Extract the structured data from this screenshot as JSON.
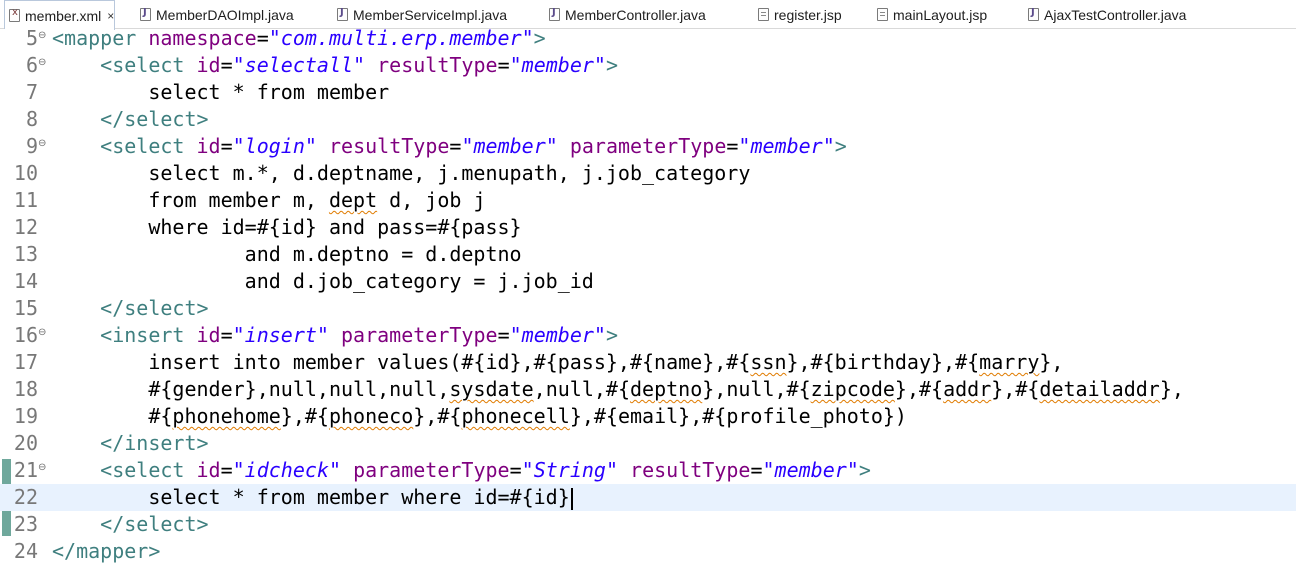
{
  "tabs": [
    {
      "label": "member.xml",
      "icon": "xml-file-icon",
      "active": true
    },
    {
      "label": "MemberDAOImpl.java",
      "icon": "java-file-icon"
    },
    {
      "label": "MemberServiceImpl.java",
      "icon": "java-file-icon"
    },
    {
      "label": "MemberController.java",
      "icon": "java-file-icon"
    },
    {
      "label": "register.jsp",
      "icon": "jsp-file-icon"
    },
    {
      "label": "mainLayout.jsp",
      "icon": "jsp-file-icon"
    },
    {
      "label": "AjaxTestController.java",
      "icon": "java-file-icon"
    }
  ],
  "tab_close_glyph": "×",
  "editor": {
    "current_line": 22,
    "lines": [
      {
        "n": "5",
        "fold": "⊖",
        "segs": [
          [
            "tag",
            "<mapper "
          ],
          [
            "att",
            "namespace"
          ],
          [
            "plain",
            "="
          ],
          [
            "val",
            "\"com.multi.erp.member\""
          ],
          [
            "tag",
            ">"
          ]
        ]
      },
      {
        "n": "6",
        "fold": "⊖",
        "segs": [
          [
            "plain",
            "    "
          ],
          [
            "tag",
            "<select "
          ],
          [
            "att",
            "id"
          ],
          [
            "plain",
            "="
          ],
          [
            "val",
            "\"selectall\""
          ],
          [
            "plain",
            " "
          ],
          [
            "att",
            "resultType"
          ],
          [
            "plain",
            "="
          ],
          [
            "val",
            "\"member\""
          ],
          [
            "tag",
            ">"
          ]
        ]
      },
      {
        "n": "7",
        "segs": [
          [
            "plain",
            "        select * from member"
          ]
        ]
      },
      {
        "n": "8",
        "segs": [
          [
            "plain",
            "    "
          ],
          [
            "tag",
            "</select>"
          ]
        ]
      },
      {
        "n": "9",
        "fold": "⊖",
        "segs": [
          [
            "plain",
            "    "
          ],
          [
            "tag",
            "<select "
          ],
          [
            "att",
            "id"
          ],
          [
            "plain",
            "="
          ],
          [
            "val",
            "\"login\""
          ],
          [
            "plain",
            " "
          ],
          [
            "att",
            "resultType"
          ],
          [
            "plain",
            "="
          ],
          [
            "val",
            "\"member\""
          ],
          [
            "plain",
            " "
          ],
          [
            "att",
            "parameterType"
          ],
          [
            "plain",
            "="
          ],
          [
            "val",
            "\"member\""
          ],
          [
            "tag",
            ">"
          ]
        ]
      },
      {
        "n": "10",
        "segs": [
          [
            "plain",
            "        select m.*, d.deptname, j.menupath, j.job_category"
          ]
        ]
      },
      {
        "n": "11",
        "segs": [
          [
            "plain",
            "        from member m, "
          ],
          [
            "ul",
            "dept"
          ],
          [
            "plain",
            " d, job j"
          ]
        ]
      },
      {
        "n": "12",
        "segs": [
          [
            "plain",
            "        where id=#{id} and pass=#{pass}"
          ]
        ]
      },
      {
        "n": "13",
        "segs": [
          [
            "plain",
            "                and m.deptno = d.deptno"
          ]
        ]
      },
      {
        "n": "14",
        "segs": [
          [
            "plain",
            "                and d.job_category = j.job_id"
          ]
        ]
      },
      {
        "n": "15",
        "segs": [
          [
            "plain",
            "    "
          ],
          [
            "tag",
            "</select>"
          ]
        ]
      },
      {
        "n": "16",
        "fold": "⊖",
        "segs": [
          [
            "plain",
            "    "
          ],
          [
            "tag",
            "<insert "
          ],
          [
            "att",
            "id"
          ],
          [
            "plain",
            "="
          ],
          [
            "val",
            "\"insert\""
          ],
          [
            "plain",
            " "
          ],
          [
            "att",
            "parameterType"
          ],
          [
            "plain",
            "="
          ],
          [
            "val",
            "\"member\""
          ],
          [
            "tag",
            ">"
          ]
        ]
      },
      {
        "n": "17",
        "segs": [
          [
            "plain",
            "        insert into member values(#{id},#{pass},#{name},#{"
          ],
          [
            "ul",
            "ssn"
          ],
          [
            "plain",
            "},#{birthday},#{"
          ],
          [
            "ul",
            "marry"
          ],
          [
            "plain",
            "},"
          ]
        ]
      },
      {
        "n": "18",
        "segs": [
          [
            "plain",
            "        #{gender},null,null,null,"
          ],
          [
            "ul",
            "sysdate"
          ],
          [
            "plain",
            ",null,#{"
          ],
          [
            "ul",
            "deptno"
          ],
          [
            "plain",
            "},null,#{"
          ],
          [
            "ul",
            "zipcode"
          ],
          [
            "plain",
            "},#{"
          ],
          [
            "ul",
            "addr"
          ],
          [
            "plain",
            "},#{"
          ],
          [
            "ul",
            "detailaddr"
          ],
          [
            "plain",
            "},"
          ]
        ]
      },
      {
        "n": "19",
        "segs": [
          [
            "plain",
            "        #{"
          ],
          [
            "ul",
            "phonehome"
          ],
          [
            "plain",
            "},#{"
          ],
          [
            "ul",
            "phoneco"
          ],
          [
            "plain",
            "},#{"
          ],
          [
            "ul",
            "phonecell"
          ],
          [
            "plain",
            "},#{email},#{profile_photo})"
          ]
        ]
      },
      {
        "n": "20",
        "segs": [
          [
            "plain",
            "    "
          ],
          [
            "tag",
            "</insert>"
          ]
        ]
      },
      {
        "n": "21",
        "fold": "⊖",
        "segs": [
          [
            "plain",
            "    "
          ],
          [
            "tag",
            "<select "
          ],
          [
            "att",
            "id"
          ],
          [
            "plain",
            "="
          ],
          [
            "val",
            "\"idcheck\""
          ],
          [
            "plain",
            " "
          ],
          [
            "att",
            "parameterType"
          ],
          [
            "plain",
            "="
          ],
          [
            "val",
            "\"String\""
          ],
          [
            "plain",
            " "
          ],
          [
            "att",
            "resultType"
          ],
          [
            "plain",
            "="
          ],
          [
            "val",
            "\"member\""
          ],
          [
            "tag",
            ">"
          ]
        ]
      },
      {
        "n": "22",
        "segs": [
          [
            "plain",
            "        select * from member where id=#{id}"
          ]
        ]
      },
      {
        "n": "23",
        "segs": [
          [
            "plain",
            "    "
          ],
          [
            "tag",
            "</select>"
          ]
        ]
      },
      {
        "n": "24",
        "segs": [
          [
            "tag",
            "</mapper>"
          ]
        ]
      }
    ]
  },
  "colors": {
    "tag": "#3f7f7f",
    "attribute": "#7f007f",
    "string": "#2a00ff",
    "line_number": "#787878",
    "current_line_bg": "#e8f2fe",
    "change_marker": "#6fa89c"
  }
}
